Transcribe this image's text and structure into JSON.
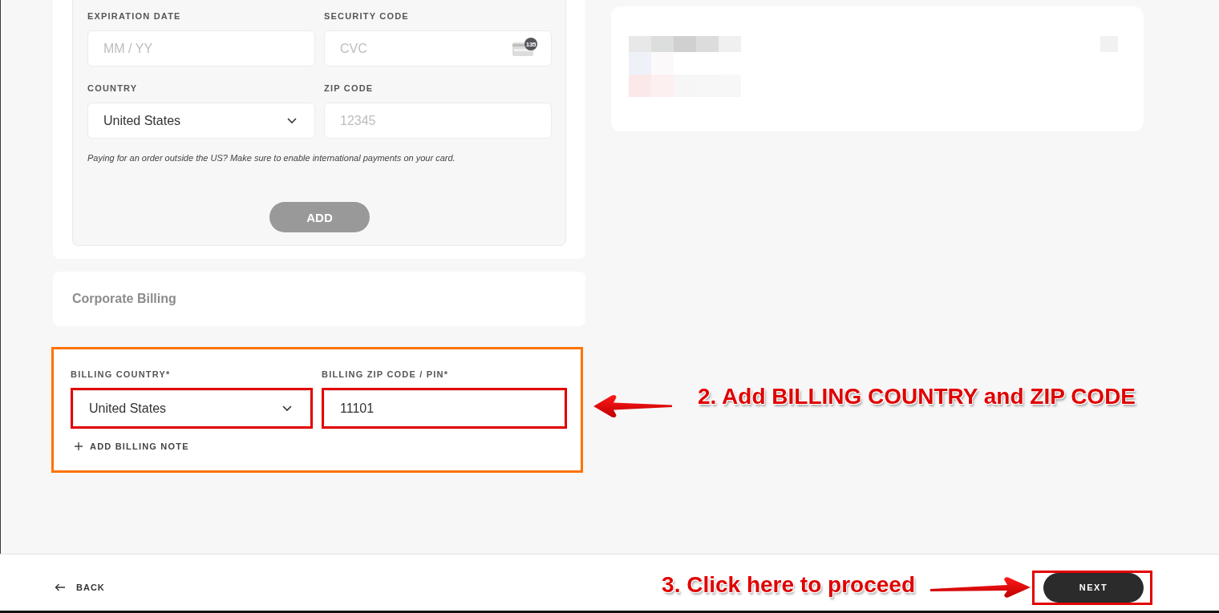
{
  "payment_card": {
    "fields": [
      {
        "kind": "text",
        "label": "EXPIRATION DATE",
        "placeholder": "MM / YY"
      },
      {
        "kind": "cvc",
        "label": "SECURITY CODE",
        "placeholder": "CVC",
        "badge": "135"
      },
      {
        "kind": "select",
        "label": "COUNTRY",
        "value": "United States"
      },
      {
        "kind": "text",
        "label": "ZIP CODE",
        "placeholder": "12345"
      }
    ],
    "note": "Paying for an order outside the US? Make sure to enable international payments on your card.",
    "add_button": {
      "label": "ADD",
      "disabled": true
    }
  },
  "corporate_billing": {
    "title": "Corporate Billing"
  },
  "billing": {
    "highlighted": true,
    "fields": [
      {
        "kind": "select",
        "label": "BILLING COUNTRY*",
        "value": "United States",
        "highlighted": true
      },
      {
        "kind": "text",
        "label": "BILLING ZIP CODE / PIN*",
        "value": "11101",
        "highlighted": true
      }
    ],
    "add_note": "ADD BILLING NOTE",
    "annotation": "2. Add BILLING COUNTRY and ZIP CODE"
  },
  "footer": {
    "back": "BACK",
    "annotation": "3. Click here to proceed",
    "next": {
      "label": "NEXT",
      "highlighted": true
    }
  }
}
